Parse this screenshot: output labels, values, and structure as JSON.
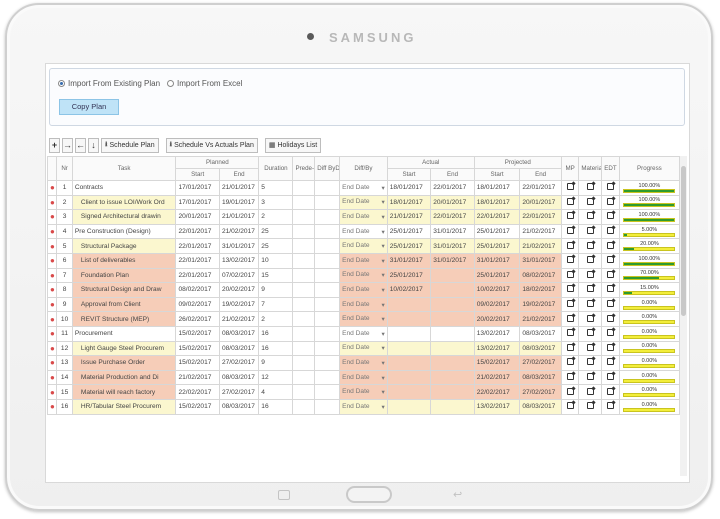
{
  "device": {
    "brand": "SAMSUNG"
  },
  "import_panel": {
    "option_existing": "Import From Existing Plan",
    "option_excel": "Import From Excel",
    "copy_button": "Copy Plan"
  },
  "toolbar": {
    "schedule_plan": "Schedule Plan",
    "schedule_vs_actuals": "Schedule Vs Actuals Plan",
    "holidays_list": "Holidays List"
  },
  "columns": {
    "no": "Nr",
    "task": "Task",
    "planned": "Planned",
    "start": "Start",
    "end": "End",
    "duration": "Duration",
    "predecessor": "Prede-cessor",
    "diff_by_day": "Diff ByDay",
    "diff_type": "Diff/By",
    "actual": "Actual",
    "projected": "Projected",
    "mp": "MP",
    "material": "Material",
    "edt": "EDT",
    "progress": "Progress"
  },
  "colors": {
    "parent_row": "#ffffff",
    "yellow_row": "#fbf7cf",
    "orange_row": "#f6cdb8",
    "progress_green": "#2e9b2e",
    "progress_yellow": "#f3ee3b",
    "copy_button": "#bfe3f7"
  },
  "rows": [
    {
      "nr": "1",
      "task": "Contracts",
      "ps": "17/01/2017",
      "pe": "21/01/2017",
      "dur": "5",
      "dtype": "End Date",
      "as": "18/01/2017",
      "ae": "22/01/2017",
      "prs": "18/01/2017",
      "pre": "22/01/2017",
      "progress_label": "100.00%",
      "progress": 1.0,
      "style": "parent"
    },
    {
      "nr": "2",
      "task": "Client to issue LOI/Work Ord",
      "ps": "17/01/2017",
      "pe": "19/01/2017",
      "dur": "3",
      "dtype": "End Date",
      "as": "18/01/2017",
      "ae": "20/01/2017",
      "prs": "18/01/2017",
      "pre": "20/01/2017",
      "progress_label": "100.00%",
      "progress": 1.0,
      "style": "yellow"
    },
    {
      "nr": "3",
      "task": "Signed Architectural drawin",
      "ps": "20/01/2017",
      "pe": "21/01/2017",
      "dur": "2",
      "dtype": "End Date",
      "as": "21/01/2017",
      "ae": "22/01/2017",
      "prs": "22/01/2017",
      "pre": "22/01/2017",
      "progress_label": "100.00%",
      "progress": 1.0,
      "style": "yellow"
    },
    {
      "nr": "4",
      "task": "Pre Construction (Design)",
      "ps": "22/01/2017",
      "pe": "21/02/2017",
      "dur": "25",
      "dtype": "End Date",
      "as": "25/01/2017",
      "ae": "31/01/2017",
      "prs": "25/01/2017",
      "pre": "21/02/2017",
      "progress_label": "5.00%",
      "progress": 0.05,
      "style": "parent"
    },
    {
      "nr": "5",
      "task": "Structural Package",
      "ps": "22/01/2017",
      "pe": "31/01/2017",
      "dur": "25",
      "dtype": "End Date",
      "as": "25/01/2017",
      "ae": "31/01/2017",
      "prs": "25/01/2017",
      "pre": "21/02/2017",
      "progress_label": "20.00%",
      "progress": 0.2,
      "style": "yellow"
    },
    {
      "nr": "6",
      "task": "List of deliverables",
      "ps": "22/01/2017",
      "pe": "13/02/2017",
      "dur": "10",
      "dtype": "End Date",
      "as": "31/01/2017",
      "ae": "31/01/2017",
      "prs": "31/01/2017",
      "pre": "31/01/2017",
      "progress_label": "100.00%",
      "progress": 1.0,
      "style": "orange"
    },
    {
      "nr": "7",
      "task": "Foundation Plan",
      "ps": "22/01/2017",
      "pe": "07/02/2017",
      "dur": "15",
      "dtype": "End Date",
      "as": "25/01/2017",
      "ae": "",
      "prs": "25/01/2017",
      "pre": "08/02/2017",
      "progress_label": "70.00%",
      "progress": 0.7,
      "style": "orange"
    },
    {
      "nr": "8",
      "task": "Structural Design and Draw",
      "ps": "08/02/2017",
      "pe": "20/02/2017",
      "dur": "9",
      "dtype": "End Date",
      "as": "10/02/2017",
      "ae": "",
      "prs": "10/02/2017",
      "pre": "18/02/2017",
      "progress_label": "15.00%",
      "progress": 0.15,
      "style": "orange"
    },
    {
      "nr": "9",
      "task": "Approval from Client",
      "ps": "09/02/2017",
      "pe": "19/02/2017",
      "dur": "7",
      "dtype": "End Date",
      "as": "",
      "ae": "",
      "prs": "09/02/2017",
      "pre": "19/02/2017",
      "progress_label": "0.00%",
      "progress": 0.0,
      "style": "orange"
    },
    {
      "nr": "10",
      "task": "REVIT Structure (MEP)",
      "ps": "26/02/2017",
      "pe": "21/02/2017",
      "dur": "2",
      "dtype": "End Date",
      "as": "",
      "ae": "",
      "prs": "20/02/2017",
      "pre": "21/02/2017",
      "progress_label": "0.00%",
      "progress": 0.0,
      "style": "orange"
    },
    {
      "nr": "11",
      "task": "Procurement",
      "ps": "15/02/2017",
      "pe": "08/03/2017",
      "dur": "16",
      "dtype": "End Date",
      "as": "",
      "ae": "",
      "prs": "13/02/2017",
      "pre": "08/03/2017",
      "progress_label": "0.00%",
      "progress": 0.0,
      "style": "parent"
    },
    {
      "nr": "12",
      "task": "Light Gauge Steel Procurem",
      "ps": "15/02/2017",
      "pe": "08/03/2017",
      "dur": "16",
      "dtype": "End Date",
      "as": "",
      "ae": "",
      "prs": "13/02/2017",
      "pre": "08/03/2017",
      "progress_label": "0.00%",
      "progress": 0.0,
      "style": "yellow"
    },
    {
      "nr": "13",
      "task": "Issue Purchase Order",
      "ps": "15/02/2017",
      "pe": "27/02/2017",
      "dur": "9",
      "dtype": "End Date",
      "as": "",
      "ae": "",
      "prs": "15/02/2017",
      "pre": "27/02/2017",
      "progress_label": "0.00%",
      "progress": 0.0,
      "style": "orange"
    },
    {
      "nr": "14",
      "task": "Material Production and Di",
      "ps": "21/02/2017",
      "pe": "08/03/2017",
      "dur": "12",
      "dtype": "End Date",
      "as": "",
      "ae": "",
      "prs": "21/02/2017",
      "pre": "08/03/2017",
      "progress_label": "0.00%",
      "progress": 0.0,
      "style": "orange"
    },
    {
      "nr": "15",
      "task": "Material will reach factory",
      "ps": "22/02/2017",
      "pe": "27/02/2017",
      "dur": "4",
      "dtype": "End Date",
      "as": "",
      "ae": "",
      "prs": "22/02/2017",
      "pre": "27/02/2017",
      "progress_label": "0.00%",
      "progress": 0.0,
      "style": "orange"
    },
    {
      "nr": "16",
      "task": "HR/Tabular Steel Procurem",
      "ps": "15/02/2017",
      "pe": "08/03/2017",
      "dur": "16",
      "dtype": "End Date",
      "as": "",
      "ae": "",
      "prs": "13/02/2017",
      "pre": "08/03/2017",
      "progress_label": "0.00%",
      "progress": 0.0,
      "style": "yellow"
    }
  ]
}
